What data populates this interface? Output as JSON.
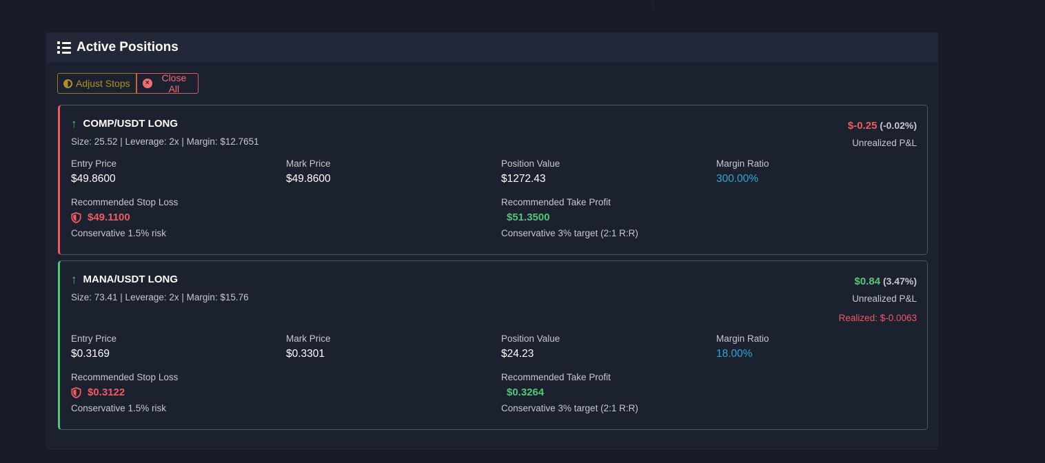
{
  "panel": {
    "title": "Active Positions",
    "icon": "list-icon"
  },
  "actions": {
    "adjust_stops_label": "Adjust Stops",
    "close_all_label": "Close All"
  },
  "positions": [
    {
      "pair": "COMP/USDT LONG",
      "direction_icon": "arrow-up-icon",
      "meta": "Size: 25.52 | Leverage: 2x | Margin: $12.7651",
      "pnl_amount": "$-0.25",
      "pnl_percent": "(-0.02%)",
      "pnl_label": "Unrealized P&L",
      "entry_label": "Entry Price",
      "entry_value": "$49.8600",
      "mark_label": "Mark Price",
      "mark_value": "$49.8600",
      "value_label": "Position Value",
      "value_value": "$1272.43",
      "ratio_label": "Margin Ratio",
      "ratio_value": "300.00%",
      "stop_label": "Recommended Stop Loss",
      "stop_value": "$49.1100",
      "stop_note": "Conservative 1.5% risk",
      "tp_label": "Recommended Take Profit",
      "tp_value": "$51.3500",
      "tp_note": "Conservative 3% target (2:1 R:R)"
    },
    {
      "pair": "MANA/USDT LONG",
      "direction_icon": "arrow-up-icon",
      "meta": "Size: 73.41 | Leverage: 2x | Margin: $15.76",
      "pnl_amount": "$0.84",
      "pnl_percent": "(3.47%)",
      "pnl_label": "Unrealized P&L",
      "realized": "Realized: $-0.0063",
      "entry_label": "Entry Price",
      "entry_value": "$0.3169",
      "mark_label": "Mark Price",
      "mark_value": "$0.3301",
      "value_label": "Position Value",
      "value_value": "$24.23",
      "ratio_label": "Margin Ratio",
      "ratio_value": "18.00%",
      "stop_label": "Recommended Stop Loss",
      "stop_value": "$0.3122",
      "stop_note": "Conservative 1.5% risk",
      "tp_label": "Recommended Take Profit",
      "tp_value": "$0.3264",
      "tp_note": "Conservative 3% target (2:1 R:R)"
    }
  ],
  "colors": {
    "loss": "#ef5b5f",
    "gain": "#52c776",
    "ratio": "#2aa7d6",
    "warning": "#b0901e"
  }
}
